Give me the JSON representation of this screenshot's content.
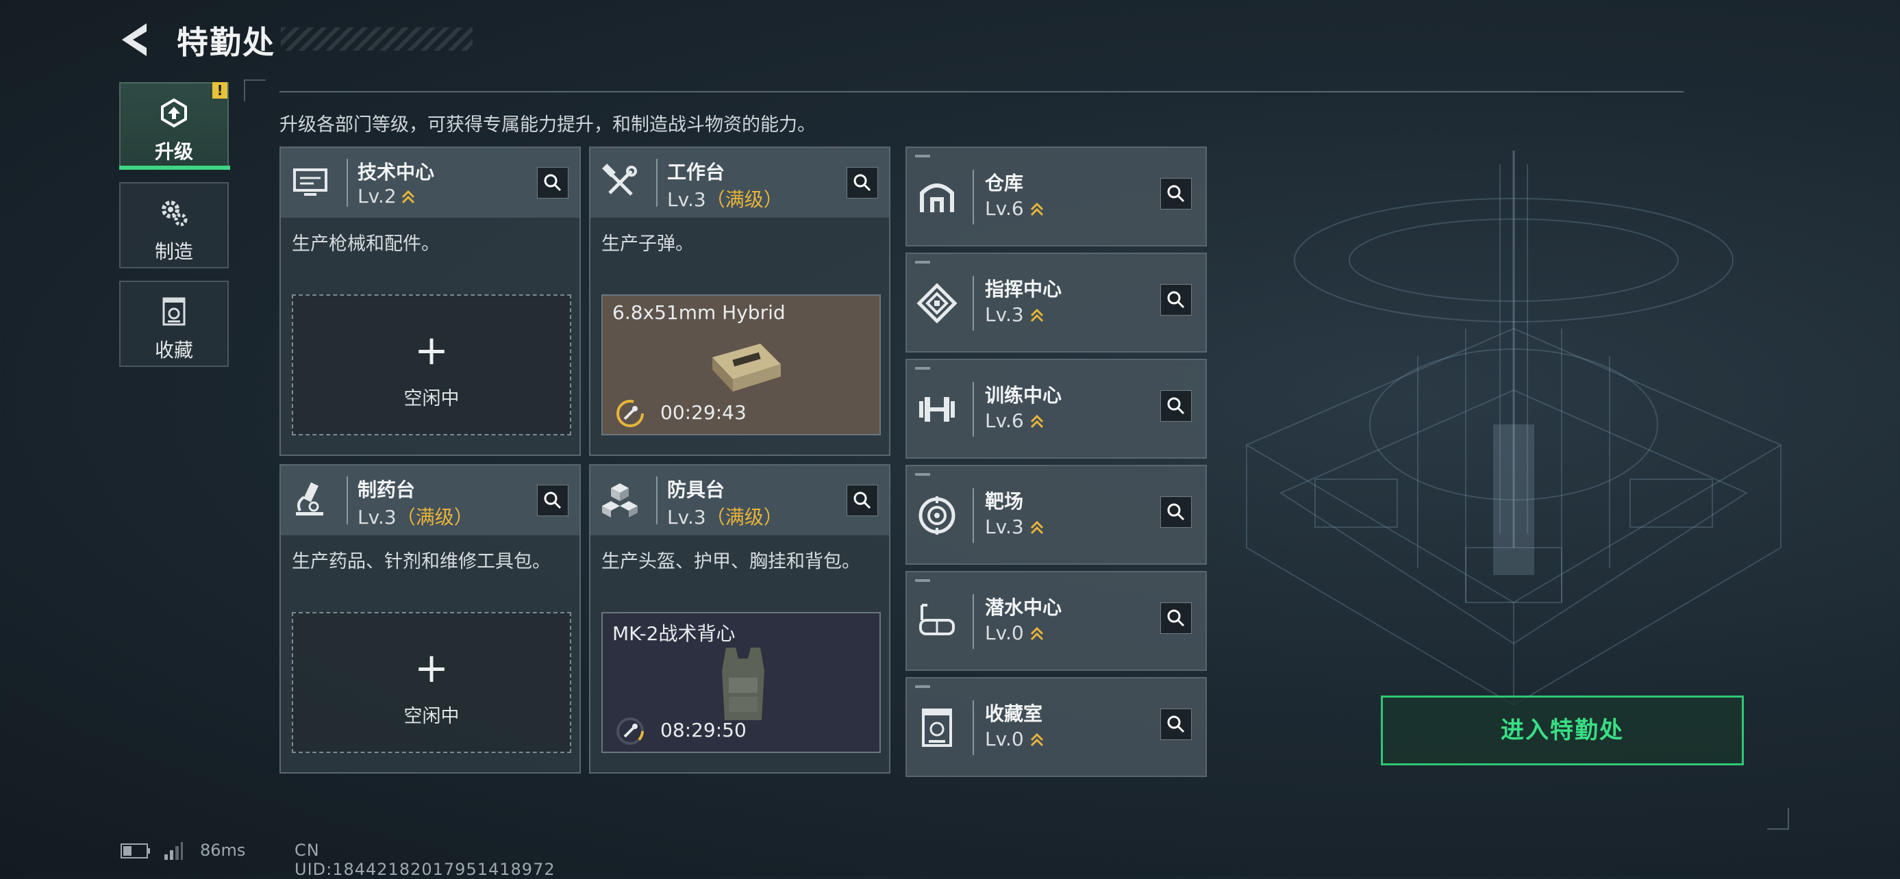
{
  "header": {
    "title": "特勤处"
  },
  "nav": [
    {
      "label": "升级",
      "icon": "upgrade-icon",
      "active": true
    },
    {
      "label": "制造",
      "icon": "gear-manufacture-icon",
      "active": false
    },
    {
      "label": "收藏",
      "icon": "collection-icon",
      "active": false
    }
  ],
  "nav_alert": "!",
  "description": "升级各部门等级，可获得专属能力提升，和制造战斗物资的能力。",
  "cards": [
    {
      "name": "技术中心",
      "level": "Lv.2",
      "max_tag": "",
      "icon": "monitor-icon",
      "desc": "生产枪械和配件。",
      "slot": {
        "type": "idle",
        "plus": "+",
        "label": "空闲中"
      }
    },
    {
      "name": "工作台",
      "level": "Lv.3",
      "max_tag": "（满级）",
      "icon": "hammer-wrench-icon",
      "desc": "生产子弹。",
      "slot": {
        "type": "producing",
        "item": "6.8x51mm Hybrid",
        "time": "00:29:43"
      }
    },
    {
      "name": "制药台",
      "level": "Lv.3",
      "max_tag": "（满级）",
      "icon": "microscope-icon",
      "desc": "生产药品、针剂和维修工具包。",
      "slot": {
        "type": "idle",
        "plus": "+",
        "label": "空闲中"
      }
    },
    {
      "name": "防具台",
      "level": "Lv.3",
      "max_tag": "（满级）",
      "icon": "cubes-icon",
      "desc": "生产头盔、护甲、胸挂和背包。",
      "slot": {
        "type": "producing",
        "item": "MK-2战术背心",
        "time": "08:29:50"
      }
    }
  ],
  "facilities": [
    {
      "name": "仓库",
      "level": "Lv.6",
      "icon": "warehouse-icon"
    },
    {
      "name": "指挥中心",
      "level": "Lv.3",
      "icon": "command-center-icon"
    },
    {
      "name": "训练中心",
      "level": "Lv.6",
      "icon": "dumbbell-icon"
    },
    {
      "name": "靶场",
      "level": "Lv.3",
      "icon": "target-icon"
    },
    {
      "name": "潜水中心",
      "level": "Lv.0",
      "icon": "diving-mask-icon"
    },
    {
      "name": "收藏室",
      "level": "Lv.0",
      "icon": "trophy-case-icon"
    }
  ],
  "enter_button": "进入特勤处",
  "status": {
    "ping": "86ms",
    "uid": "CN UID:18442182017951418972"
  },
  "colors": {
    "accent_green": "#39df85",
    "max_level": "#e8b53a",
    "level_chevron": "#e8b53a"
  }
}
